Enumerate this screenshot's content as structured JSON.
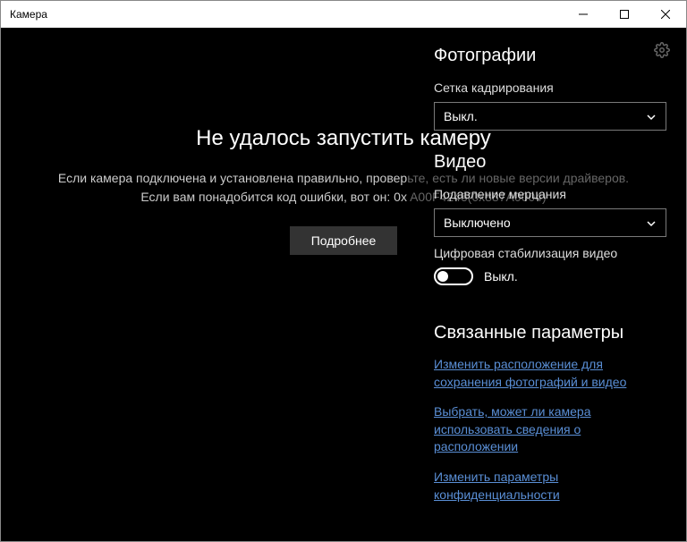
{
  "window": {
    "title": "Камера"
  },
  "error": {
    "title": "Не удалось запустить камеру",
    "line1_left": "Если камера подключена и установлена правильно, провер",
    "line1_right": "ьте, есть ли новые версии драйверов.",
    "line2_left": "Если вам понадобится код ошибки, вот он: 0x",
    "line2_right": " A00F4246(0x887A0004)",
    "details_button": "Подробнее"
  },
  "settings": {
    "photos": {
      "header": "Фотографии",
      "framing_grid_label": "Сетка кадрирования",
      "framing_grid_value": "Выкл."
    },
    "video": {
      "header": "Видео",
      "flicker_label": "Подавление мерцания",
      "flicker_value": "Выключено",
      "stabilization_label": "Цифровая стабилизация видео",
      "stabilization_state": "Выкл."
    },
    "related": {
      "header": "Связанные параметры",
      "link1": "Изменить расположение для сохранения фотографий и видео",
      "link2": "Выбрать, может ли камера использовать сведения о расположении",
      "link3": "Изменить параметры конфиденциальности"
    }
  }
}
